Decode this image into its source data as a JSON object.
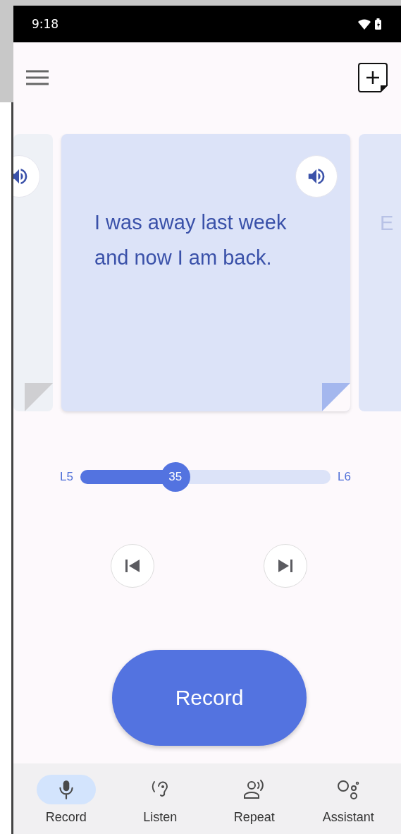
{
  "status_bar": {
    "time": "9:18"
  },
  "cards": [
    {
      "kind": "previous"
    },
    {
      "kind": "current",
      "text": "I was away last week and now I am back."
    },
    {
      "kind": "next",
      "text": "E"
    }
  ],
  "slider": {
    "start_label": "L5",
    "end_label": "L6",
    "value": "35",
    "level": 0.38
  },
  "record_button": {
    "label": "Record"
  },
  "bottom_nav": [
    {
      "label": "Record",
      "kind": "mic",
      "selected": true
    },
    {
      "label": "Listen",
      "kind": "ear",
      "selected": false
    },
    {
      "label": "Repeat",
      "kind": "speaker",
      "selected": false
    },
    {
      "label": "Assistant",
      "kind": "assistant",
      "selected": false
    }
  ]
}
